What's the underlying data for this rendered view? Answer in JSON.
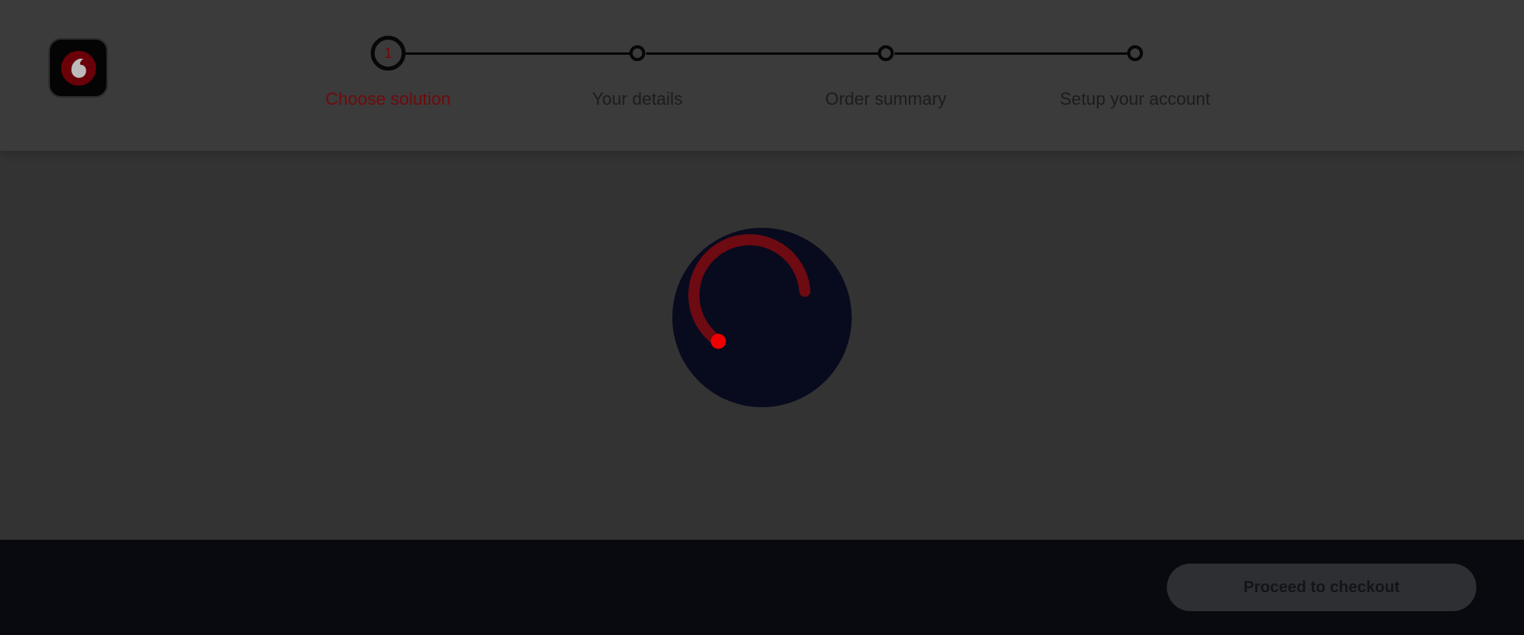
{
  "brand": {
    "logo_icon": "vodafone-speechmark-icon",
    "accent_color": "#e60000"
  },
  "stepper": {
    "active_index": 0,
    "steps": [
      {
        "number": "1",
        "label": "Choose solution",
        "state": "active"
      },
      {
        "number": "",
        "label": "Your details",
        "state": "pending"
      },
      {
        "number": "",
        "label": "Order summary",
        "state": "pending"
      },
      {
        "number": "",
        "label": "Setup your account",
        "state": "pending"
      }
    ]
  },
  "loading": {
    "spinner_icon": "loading-spinner-icon"
  },
  "footer": {
    "checkout_label": "Proceed to checkout"
  }
}
